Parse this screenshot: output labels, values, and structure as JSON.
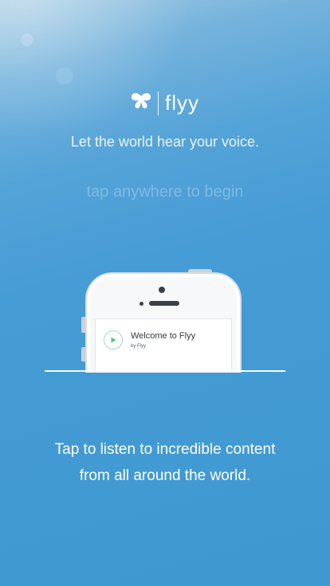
{
  "brand": {
    "name": "flyy",
    "icon": "butterfly-icon"
  },
  "tagline": "Let the world hear your voice.",
  "tap_prompt": "tap anywhere to begin",
  "phone_card": {
    "title": "Welcome to Flyy",
    "subtitle": "by Flyy",
    "icon": "play-icon"
  },
  "description": {
    "line1": "Tap to listen to incredible content",
    "line2": "from all around the world."
  },
  "colors": {
    "background": "#3f98d0",
    "play_accent": "#5cc27a",
    "text": "#ffffff"
  }
}
